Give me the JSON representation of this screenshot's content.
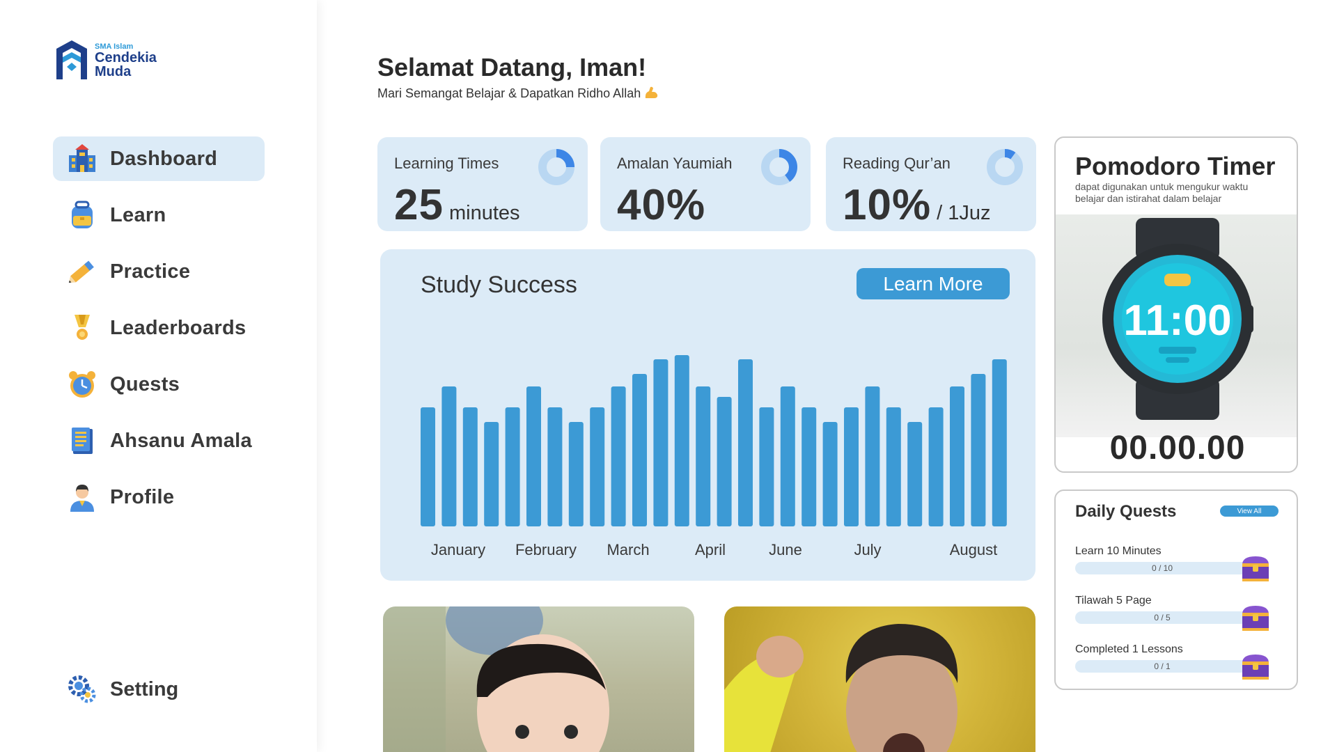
{
  "brand": {
    "school_small": "SMA Islam",
    "name_line1": "Cendekia",
    "name_line2": "Muda"
  },
  "nav": {
    "items": [
      {
        "label": "Dashboard",
        "icon": "school-building-icon",
        "active": true
      },
      {
        "label": "Learn",
        "icon": "backpack-icon"
      },
      {
        "label": "Practice",
        "icon": "pencil-icon"
      },
      {
        "label": "Leaderboards",
        "icon": "medal-icon"
      },
      {
        "label": "Quests",
        "icon": "alarm-clock-icon"
      },
      {
        "label": "Ahsanu Amala",
        "icon": "notebook-icon"
      },
      {
        "label": "Profile",
        "icon": "person-icon"
      }
    ],
    "setting": {
      "label": "Setting",
      "icon": "gear-icon"
    }
  },
  "header": {
    "greeting": "Selamat Datang, Iman!",
    "subtitle": "Mari Semangat Belajar & Dapatkan Ridho Allah"
  },
  "stats": [
    {
      "label": "Learning Times",
      "value": "25",
      "unit": "minutes",
      "progress": 0.25
    },
    {
      "label": "Amalan Yaumiah",
      "value": "40%",
      "unit": "",
      "progress": 0.4
    },
    {
      "label": "Reading Qur’an",
      "value": "10%",
      "unit": "/ 1Juz",
      "progress": 0.1
    }
  ],
  "study": {
    "title": "Study Success",
    "button_label": "Learn More"
  },
  "chart_data": {
    "type": "bar",
    "title": "Study Success",
    "xlabel": "",
    "ylabel": "",
    "tick_labels": [
      "January",
      "February",
      "March",
      "April",
      "June",
      "July",
      "August"
    ],
    "values": [
      57,
      67,
      57,
      50,
      57,
      67,
      57,
      50,
      57,
      67,
      73,
      80,
      82,
      67,
      62,
      80,
      57,
      67,
      57,
      50,
      57,
      67,
      57,
      50,
      57,
      67,
      73,
      80
    ],
    "ylim": [
      0,
      100
    ],
    "grid": false,
    "color": "#3c9ad5"
  },
  "pomodoro": {
    "title": "Pomodoro Timer",
    "description": "dapat digunakan untuk mengukur waktu belajar dan istirahat dalam belajar",
    "watch_face": "11:00",
    "time": "00.00.00"
  },
  "daily_quests": {
    "title": "Daily Quests",
    "view_all": "View All",
    "items": [
      {
        "name": "Learn 10 Minutes",
        "progress": "0 / 10",
        "icon": "treasure-chest-icon"
      },
      {
        "name": "Tilawah 5 Page",
        "progress": "0 / 5",
        "icon": "treasure-chest-icon"
      },
      {
        "name": "Completed 1 Lessons",
        "progress": "0 / 1",
        "icon": "treasure-chest-icon"
      }
    ]
  },
  "colors": {
    "accent": "#3c9ad5",
    "card_bg": "#dcebf7",
    "brand_navy": "#1e3f8a"
  }
}
